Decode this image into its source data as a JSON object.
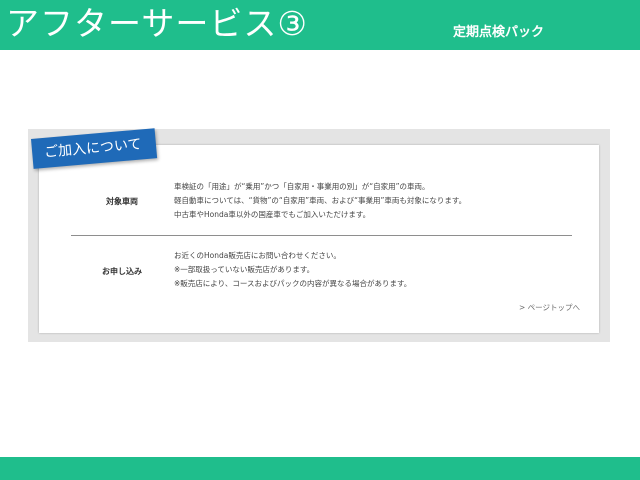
{
  "header": {
    "title": "アフターサービス③",
    "subtitle": "定期点検パック"
  },
  "section": {
    "ribbon_label": "ご加入について",
    "rows": [
      {
        "label": "対象車両",
        "lines": [
          "車検証の「用途」が“乗用”かつ「自家用・事業用の別」が“自家用”の車両。",
          "軽自動車については、“貨物”の“自家用”車両、および“事業用”車両も対象になります。",
          "中古車やHonda車以外の国産車でもご加入いただけます。"
        ]
      },
      {
        "label": "お申し込み",
        "lines": [
          "お近くのHonda販売店にお問い合わせください。",
          "※一部取扱っていない販売店があります。",
          "※販売店により、コースおよびパックの内容が異なる場合があります。"
        ]
      }
    ],
    "page_top_link": "> ページトップへ"
  },
  "colors": {
    "header_green": "#1fbe8c",
    "ribbon_blue": "#1f6ab8",
    "panel_gray": "#e4e4e4"
  }
}
